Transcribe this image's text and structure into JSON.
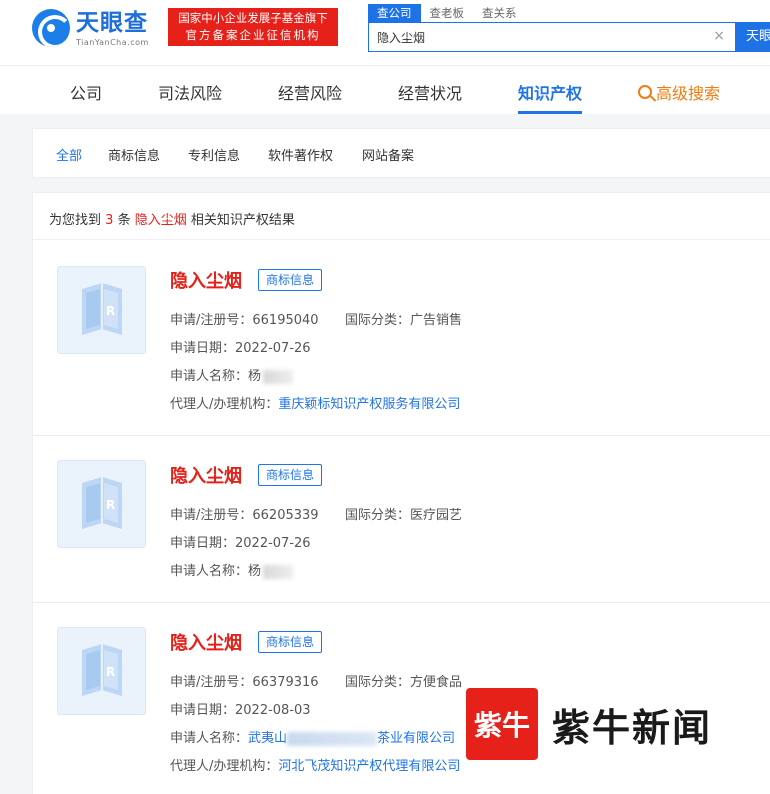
{
  "header": {
    "logo_cn": "天眼查",
    "logo_en": "TianYanCha.com",
    "badge_line1": "国家中小企业发展子基金旗下",
    "badge_line2": "官方备案企业征信机构",
    "search_tabs": [
      "查公司",
      "查老板",
      "查关系"
    ],
    "search_value": "隐入尘烟",
    "search_button": "天眼"
  },
  "nav": {
    "items": [
      "公司",
      "司法风险",
      "经营风险",
      "经营状况",
      "知识产权"
    ],
    "active": "知识产权",
    "advanced": "高级搜索"
  },
  "subtabs": [
    "全部",
    "商标信息",
    "专利信息",
    "软件著作权",
    "网站备案"
  ],
  "summary": {
    "prefix": "为您找到",
    "count": "3",
    "unit": "条",
    "keyword": "隐入尘烟",
    "suffix": "相关知识产权结果"
  },
  "labels": {
    "reg_no": "申请/注册号：",
    "intl_class": "国际分类：",
    "apply_date": "申请日期：",
    "applicant": "申请人名称：",
    "agent": "代理人/办理机构："
  },
  "results": [
    {
      "title": "隐入尘烟",
      "tag": "商标信息",
      "reg_no": "66195040",
      "intl_class": "广告销售",
      "apply_date": "2022-07-26",
      "applicant": "杨",
      "agent": "重庆颖标知识产权服务有限公司"
    },
    {
      "title": "隐入尘烟",
      "tag": "商标信息",
      "reg_no": "66205339",
      "intl_class": "医疗园艺",
      "apply_date": "2022-07-26",
      "applicant": "杨",
      "agent": ""
    },
    {
      "title": "隐入尘烟",
      "tag": "商标信息",
      "reg_no": "66379316",
      "intl_class": "方便食品",
      "apply_date": "2022-08-03",
      "applicant_prefix": "武夷山",
      "applicant_suffix": "茶业有限公司",
      "agent": "河北飞茂知识产权代理有限公司"
    }
  ],
  "watermark": {
    "box_text": "紫牛",
    "text": "紫牛新闻"
  },
  "colors": {
    "brand_blue": "#1f74e8",
    "brand_red": "#e5211a",
    "accent_orange": "#f07c15"
  }
}
